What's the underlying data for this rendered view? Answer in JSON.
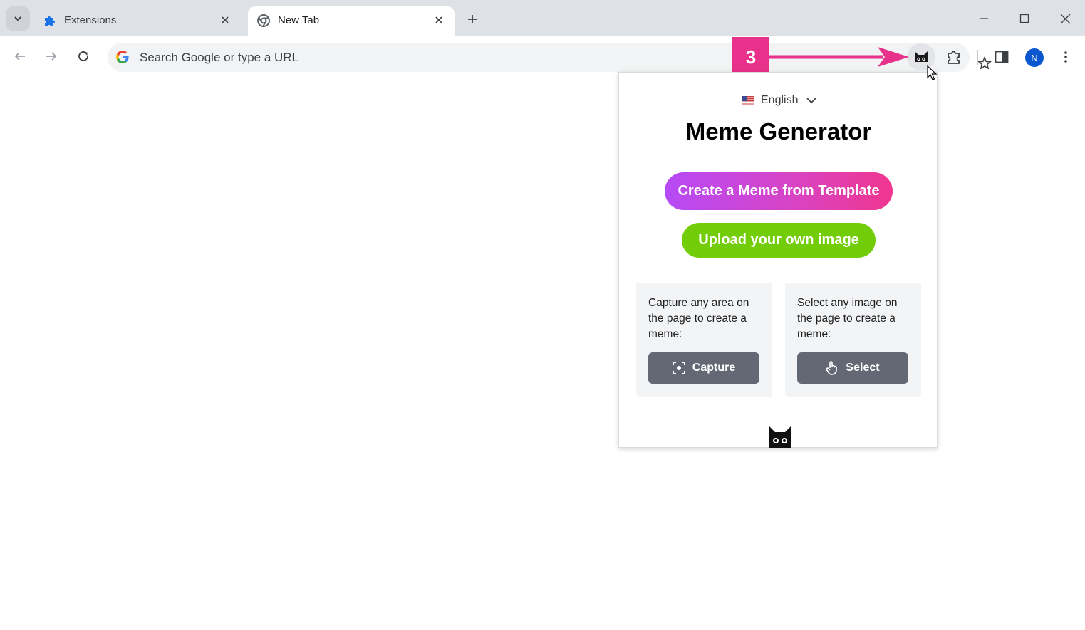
{
  "browser": {
    "tabs": [
      {
        "title": "Extensions",
        "icon": "puzzle-icon",
        "active": false
      },
      {
        "title": "New Tab",
        "icon": "chrome-icon",
        "active": true
      }
    ],
    "omnibox": {
      "placeholder": "Search Google or type a URL"
    },
    "profile_initial": "N",
    "colors": {
      "tabstrip": "#dee1e6",
      "accent_blue": "#0b57d0"
    }
  },
  "annotation": {
    "step_number": "3",
    "color": "#e8318a"
  },
  "popup": {
    "language": "English",
    "title": "Meme Generator",
    "template_button": "Create a Meme from Template",
    "upload_button": "Upload your own image",
    "capture_card": {
      "text": "Capture any area on the page to create a meme:",
      "button": "Capture"
    },
    "select_card": {
      "text": "Select any image on the page to create a meme:",
      "button": "Select"
    },
    "colors": {
      "template_gradient_start": "#b64af6",
      "template_gradient_end": "#f0368e",
      "upload_green": "#72cd08",
      "card_button_gray": "#646875"
    }
  }
}
